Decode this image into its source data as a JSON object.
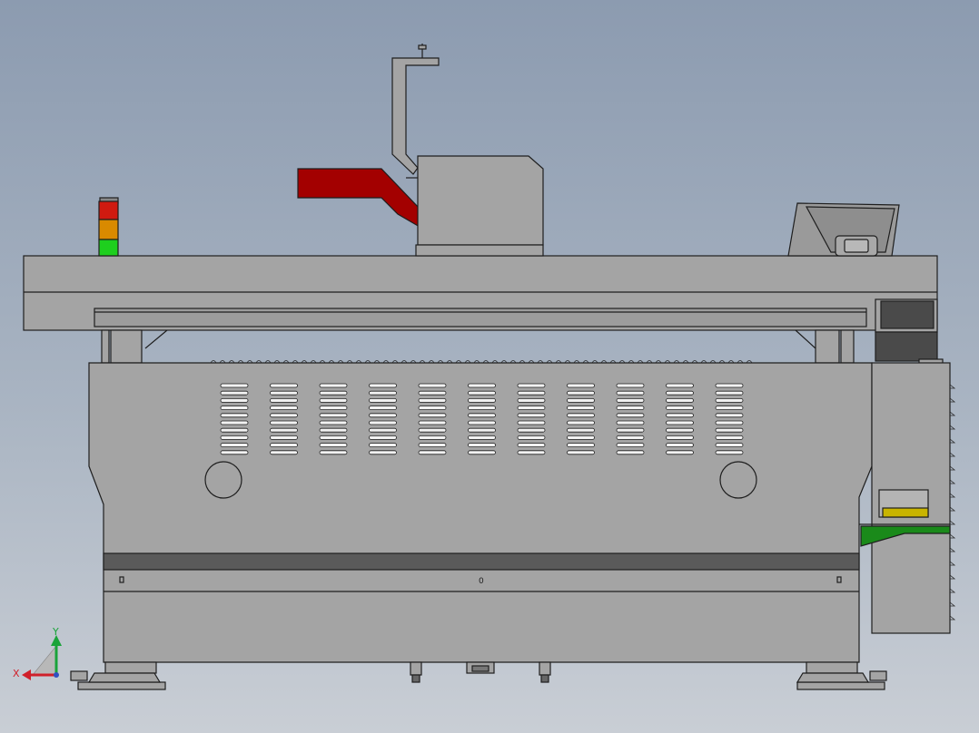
{
  "viewport": {
    "background_top": "#8c9bb0",
    "background_bottom": "#c9ced5"
  },
  "machine": {
    "body_color": "#a4a4a4",
    "dark_panel_color": "#4a4a4a",
    "outline_color": "#1e1e1e",
    "accent_color": "#a30000",
    "signal_tower": [
      "#d01a10",
      "#d98a00",
      "#1ecf1e"
    ],
    "fan_labels": [
      "0",
      "0",
      "0"
    ]
  },
  "triad": {
    "x_label": "X",
    "y_label": "Y",
    "x_color": "#d0202a",
    "y_color": "#1aa33a"
  }
}
